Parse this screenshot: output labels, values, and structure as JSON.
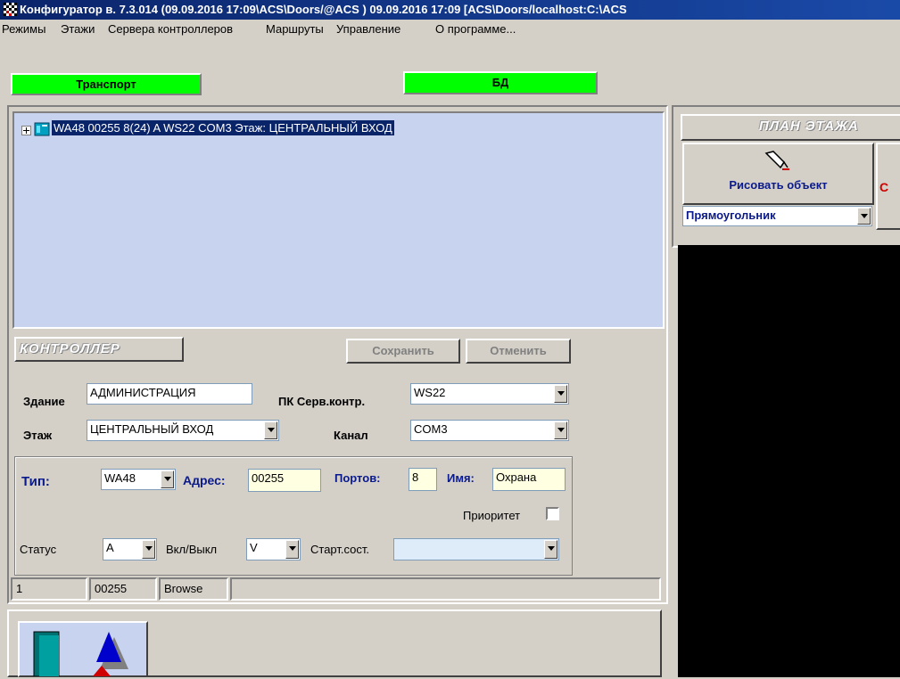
{
  "window": {
    "title": "Конфигуратор в. 7.3.014 (09.09.2016 17:09\\ACS\\Doors/@ACS ) 09.09.2016 17:09 [ACS\\Doors/localhost:C:\\ACS"
  },
  "menu": [
    "Режимы",
    "Этажи",
    "Сервера контроллеров",
    "Маршруты",
    "Управление",
    "О программе..."
  ],
  "status_indicators": {
    "transport": "Транспорт",
    "db": "БД",
    "color": "#00ff00"
  },
  "tree": {
    "node_text": "WA48 00255 8(24) A WS22 COM3 Этаж: ЦЕНТРАЛЬНЫЙ ВХОД"
  },
  "controller": {
    "header": "КОНТРОЛЛЕР",
    "save_label": "Сохранить",
    "cancel_label": "Отменить",
    "building_label": "Здание",
    "building_value": "АДМИНИСТРАЦИЯ",
    "pc_server_label": "ПК Серв.контр.",
    "pc_server_value": "WS22",
    "floor_label": "Этаж",
    "floor_value": "ЦЕНТРАЛЬНЫЙ ВХОД",
    "channel_label": "Канал",
    "channel_value": "COM3",
    "type_label": "Тип:",
    "type_value": "WA48",
    "address_label": "Адрес:",
    "address_value": "00255",
    "ports_label": "Портов:",
    "ports_value": "8",
    "name_label": "Имя:",
    "name_value": "Охрана",
    "priority_label": "Приоритет",
    "status_label": "Статус",
    "status_value": "A",
    "onoff_label": "Вкл/Выкл",
    "onoff_value": "V",
    "start_state_label": "Старт.сост.",
    "start_state_value": ""
  },
  "statusbar": {
    "cell1": "1",
    "cell2": "00255",
    "cell3": "Browse"
  },
  "floor_plan": {
    "header": "ПЛАН ЭТАЖА",
    "draw_button": "Рисовать объект",
    "shape_select": "Прямоугольник"
  }
}
